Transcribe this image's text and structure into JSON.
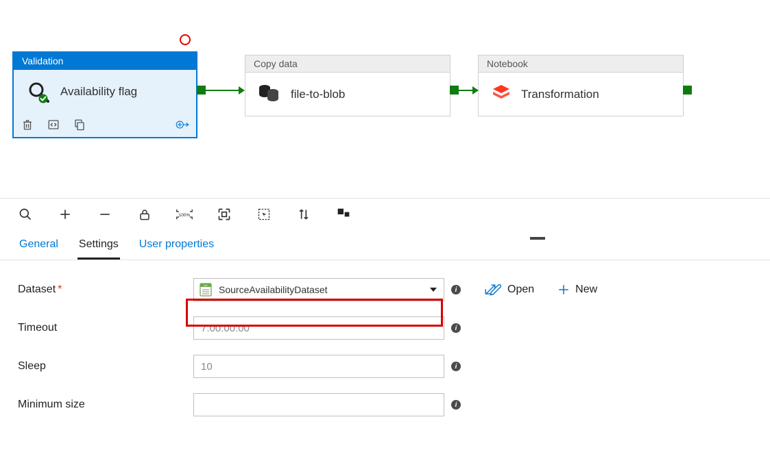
{
  "activities": {
    "validation": {
      "type_label": "Validation",
      "title": "Availability flag"
    },
    "copy": {
      "type_label": "Copy data",
      "title": "file-to-blob"
    },
    "notebook": {
      "type_label": "Notebook",
      "title": "Transformation"
    }
  },
  "tabs": {
    "general": "General",
    "settings": "Settings",
    "user_props": "User properties"
  },
  "form": {
    "dataset_label": "Dataset",
    "dataset_value": "SourceAvailabilityDataset",
    "timeout_label": "Timeout",
    "timeout_placeholder": "7.00:00:00",
    "sleep_label": "Sleep",
    "sleep_placeholder": "10",
    "minsize_label": "Minimum size",
    "open_label": "Open",
    "new_label": "New"
  }
}
